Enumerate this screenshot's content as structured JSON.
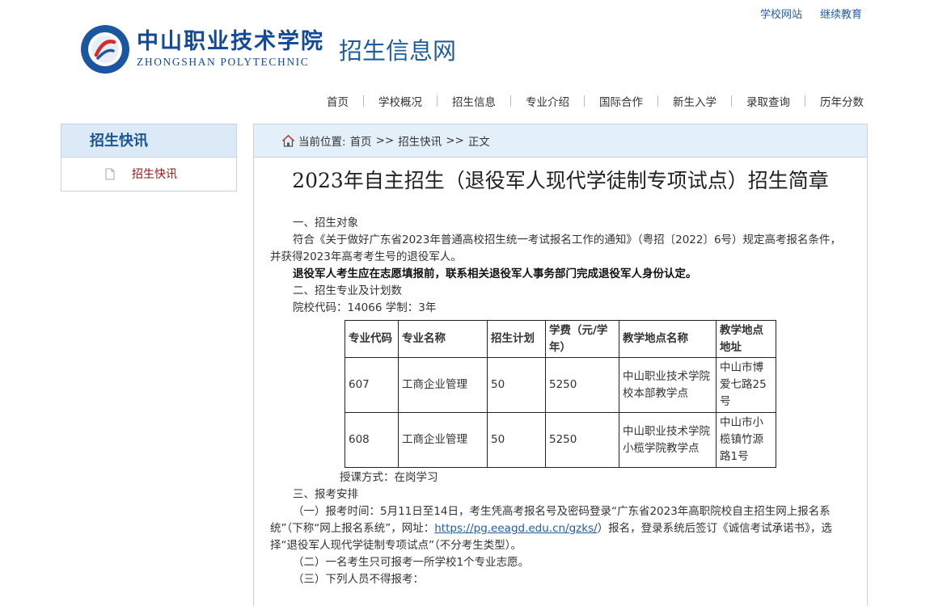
{
  "header": {
    "top_links": [
      "学校网站",
      "继续教育"
    ],
    "logo_cn": "中山职业技术学院",
    "logo_en": "ZHONGSHAN POLYTECHNIC",
    "site_name": "招生信息网"
  },
  "nav": {
    "items": [
      "首页",
      "学校概况",
      "招生信息",
      "专业介绍",
      "国际合作",
      "新生入学",
      "录取查询",
      "历年分数"
    ]
  },
  "sidebar": {
    "title": "招生快讯",
    "items": [
      {
        "label": "招生快讯",
        "icon": "document-icon"
      }
    ]
  },
  "breadcrumb": {
    "prefix": "当前位置:",
    "items": [
      "首页",
      "招生快讯",
      "正文"
    ],
    "separator": ">>"
  },
  "article": {
    "title": "2023年自主招生（退役军人现代学徒制专项试点）招生简章",
    "section1_heading": "一、招生对象",
    "section1_text": "符合《关于做好广东省2023年普通高校招生统一考试报名工作的通知》（粤招〔2022〕6号）规定高考报名条件，并获得2023年高考考生号的退役军人。",
    "section1_bold": "退役军人考生应在志愿填报前，联系相关退役军人事务部门完成退役军人身份认定。",
    "section2_heading": "二、招生专业及计划数",
    "section2_code": "院校代码：14066 学制：3年",
    "table": {
      "headers": [
        "专业代码",
        "专业名称",
        "招生计划",
        "学费（元/学年）",
        "教学地点名称",
        "教学地点地址"
      ],
      "rows": [
        [
          "607",
          "工商企业管理",
          "50",
          "5250",
          "中山职业技术学院校本部教学点",
          "中山市博爱七路25号"
        ],
        [
          "608",
          "工商企业管理",
          "50",
          "5250",
          "中山职业技术学院小榄学院教学点",
          "中山市小榄镇竹源路1号"
        ]
      ]
    },
    "teaching_mode": "授课方式：在岗学习",
    "section3_heading": "三、报考安排",
    "section3_item1_a": "（一）报考时间：5月11日至14日，考生凭高考报名号及密码登录“广东省2023年高职院校自主招生网上报名系统”（下称“网上报名系统”，网址：",
    "section3_item1_link": "https://pg.eeagd.edu.cn/gzks/",
    "section3_item1_b": "）报名，登录系统后签订《诚信考试承诺书》，选择“退役军人现代学徒制专项试点”（不分考生类型）。",
    "section3_item2": "（二）一名考生只可报考一所学校1个专业志愿。",
    "section3_item3": "（三）下列人员不得报考："
  },
  "colors": {
    "brand": "#1f5e9e",
    "sidebar_accent": "#9a1414"
  }
}
